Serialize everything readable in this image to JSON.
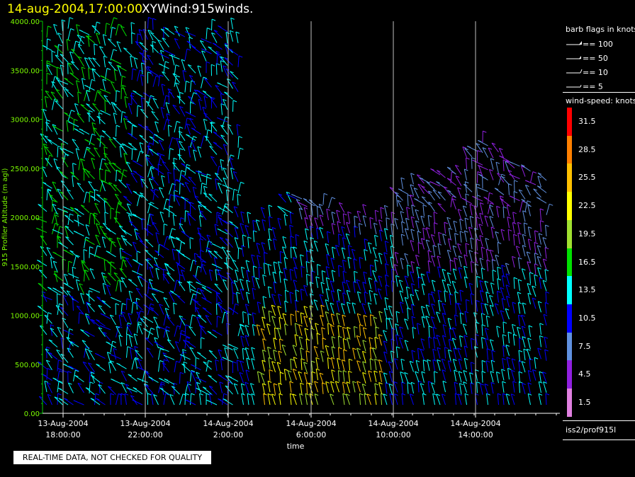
{
  "header": {
    "timestamp": "14-aug-2004,17:00:00",
    "title": "XYWind:915winds."
  },
  "legend": {
    "barb_heading": "barb flags in knots",
    "barb_flags": [
      {
        "label": "== 100"
      },
      {
        "label": "== 50"
      },
      {
        "label": "== 10"
      },
      {
        "label": "== 5"
      }
    ],
    "speed_heading": "wind-speed: knots",
    "speed_scale": [
      {
        "value": "31.5",
        "color": "#ff0000"
      },
      {
        "value": "28.5",
        "color": "#ff8000"
      },
      {
        "value": "25.5",
        "color": "#ffc000"
      },
      {
        "value": "22.5",
        "color": "#ffff00"
      },
      {
        "value": "19.5",
        "color": "#a0e030"
      },
      {
        "value": "16.5",
        "color": "#00e000"
      },
      {
        "value": "13.5",
        "color": "#00ffff"
      },
      {
        "value": "10.5",
        "color": "#0000ff"
      },
      {
        "value": "7.5",
        "color": "#6090e0"
      },
      {
        "value": "4.5",
        "color": "#9020e0"
      },
      {
        "value": "1.5",
        "color": "#e080e0"
      }
    ],
    "source": "iss2/prof915l"
  },
  "notice": "REAL-TIME DATA, NOT CHECKED FOR QUALITY",
  "chart_data": {
    "type": "wind-barb time-height",
    "title": "XYWind:915winds.",
    "xlabel": "time",
    "ylabel": "915 Profiler Altitude (m agl)",
    "ylim": [
      0,
      4000
    ],
    "yticks": [
      "0.00",
      "500.00",
      "1000.00",
      "1500.00",
      "2000.00",
      "2500.00",
      "3000.00",
      "3500.00",
      "4000.00"
    ],
    "xticks": [
      {
        "date": "13-Aug-2004",
        "time": "18:00:00"
      },
      {
        "date": "13-Aug-2004",
        "time": "22:00:00"
      },
      {
        "date": "14-Aug-2004",
        "time": "2:00:00"
      },
      {
        "date": "14-Aug-2004",
        "time": "6:00:00"
      },
      {
        "date": "14-Aug-2004",
        "time": "10:00:00"
      },
      {
        "date": "14-Aug-2004",
        "time": "14:00:00"
      }
    ],
    "grid": "vertical lines at each time tick",
    "colors": {
      "axis": "#00cc00",
      "grid": "#c0c0c0"
    }
  }
}
